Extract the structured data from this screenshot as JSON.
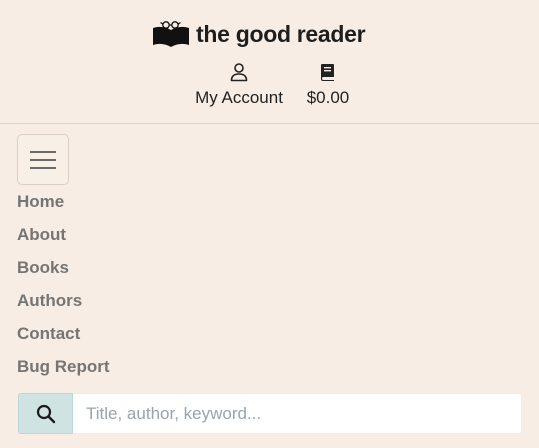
{
  "header": {
    "logo_text": "the good reader",
    "logo_icon": "open-book-with-glasses-icon",
    "account_label": "My Account",
    "account_icon": "user-icon",
    "cart_total": "$0.00",
    "cart_icon": "book-icon"
  },
  "menu": {
    "toggle_icon": "hamburger-menu-icon"
  },
  "nav": {
    "items": [
      {
        "label": "Home"
      },
      {
        "label": "About"
      },
      {
        "label": "Books"
      },
      {
        "label": "Authors"
      },
      {
        "label": "Contact"
      },
      {
        "label": "Bug Report"
      }
    ]
  },
  "search": {
    "icon": "search-icon",
    "placeholder": "Title, author, keyword..."
  },
  "colors": {
    "background": "#f7ede4",
    "search_button": "#cfe3e3",
    "nav_text": "#757575"
  }
}
